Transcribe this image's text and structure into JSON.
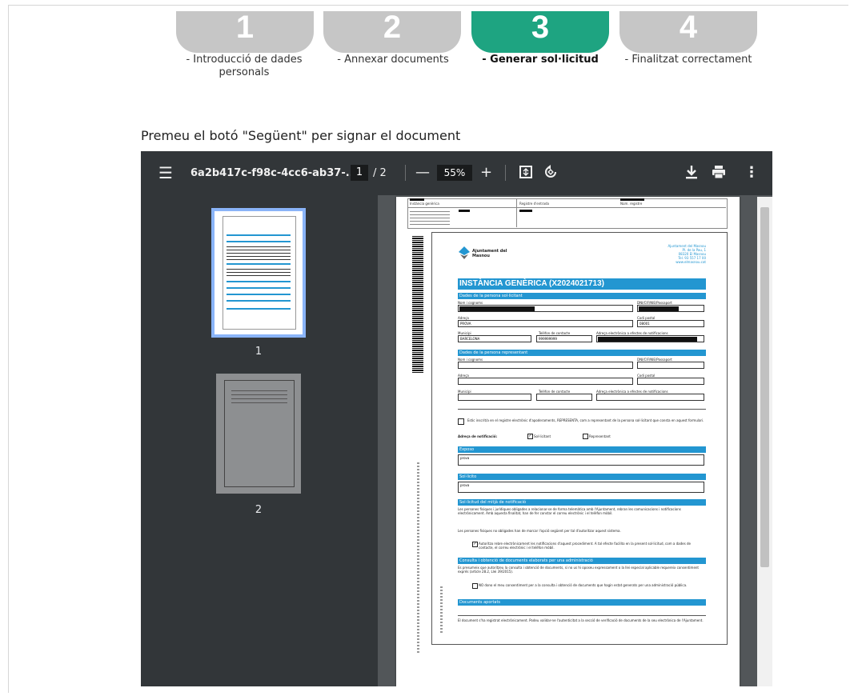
{
  "steps": [
    {
      "number": "1",
      "label": "- Introducció de dades personals",
      "active": false
    },
    {
      "number": "2",
      "label": "- Annexar documents",
      "active": false
    },
    {
      "number": "3",
      "label": "- Generar sol·licitud",
      "active": true
    },
    {
      "number": "4",
      "label": "- Finalitzat correctament",
      "active": false
    }
  ],
  "instruction": "Premeu el botó \"Següent\" per signar el document",
  "viewer": {
    "title": "6a2b417c-f98c-4cc6-ab37-...",
    "current_page": "1",
    "page_total": "/ 2",
    "zoom": "55%",
    "thumbnails": [
      {
        "num": "1"
      },
      {
        "num": "2"
      }
    ]
  },
  "document": {
    "org_name": "Ajuntament del Masnou",
    "org_address": [
      "Ajuntament del Masnou",
      "Pl. de la Pau, 1",
      "08320 El Masnou",
      "Tel. 93 557 17 00",
      "www.elmasnou.cat"
    ],
    "form_title": "INSTÀNCIA GENÈRICA (X2024021713)",
    "sec_applicant": "Dades de la persona sol·licitant",
    "sec_representative": "Dades de la persona representant",
    "lbl_name": "Nom i cognoms",
    "lbl_id": "DNI/CIF/NIE/Passaport",
    "lbl_address": "Adreça",
    "lbl_postal": "Codi postal",
    "lbl_city": "Municipi",
    "lbl_phone": "Telèfon de contacte",
    "lbl_email": "Adreça electrònica a efectes de notificacions",
    "val_address": "PROVA",
    "val_postal": "08001",
    "val_city": "BARCELONA",
    "val_phone": "999999999",
    "registry_text": "Estic inscrit/a en el registre electrònic d'apoderaments, REPRESENTA, com a representant de la persona sol·licitant que consta en aquest formulari.",
    "notif_label": "Adreça de notificació:",
    "notif_opt1": "Sol·licitant",
    "notif_opt2": "Representant",
    "sec_exposo": "Exposo",
    "val_exposo": "prova",
    "sec_solicito": "Sol·licito",
    "val_solicito": "prova",
    "sec_notif_means": "Sol·licitud del mitjà de notificació",
    "notif_text1": "Les persones físiques i jurídiques obligades a relacionar-se de forma telemàtica amb l'Ajuntament, rebran les comunicacions i notificacions electrònicament. Amb aquesta finalitat, han de fer constar el correu electrònic i el telèfon mòbil.",
    "notif_text2": "Les persones físiques no obligades han de marcar l'opció següent per tal d'autoritzar aquest sistema.",
    "notif_auth": "Autoritzo rebre electrònicament les notificacions d'aquest procediment. A tal efecte facilito en la present sol·licitud, com a dades de contacte, el correu electrònic i el telèfon mòbil.",
    "sec_consult": "Consulta i obtenció de documents elaborats per una administració",
    "consult_text": "Es presumeix que autoritzeu la consulta i obtenció de documents, si no us hi oposeu expressament o la llei especial aplicable requereix consentiment exprés (article 28.2, Llei 39/2015).",
    "consult_opt": "NO dono el meu consentiment per a la consulta i obtenció de documents que hagin estat generats per una administració pública.",
    "sec_docs": "Documents aportats",
    "footer_text": "El document s'ha registrat electrònicament. Podeu validar-ne l'autenticitat a la secció de verificació de documents de la seu electrònica de l'Ajuntament.",
    "header_cells": [
      "Instància genèrica",
      "Registre d'entrada",
      "Núm. registre"
    ]
  },
  "colors": {
    "active_step": "#1ea481",
    "inactive_step": "#c6c6c6",
    "viewer_toolbar": "#323639",
    "form_bar": "#2396d1"
  }
}
